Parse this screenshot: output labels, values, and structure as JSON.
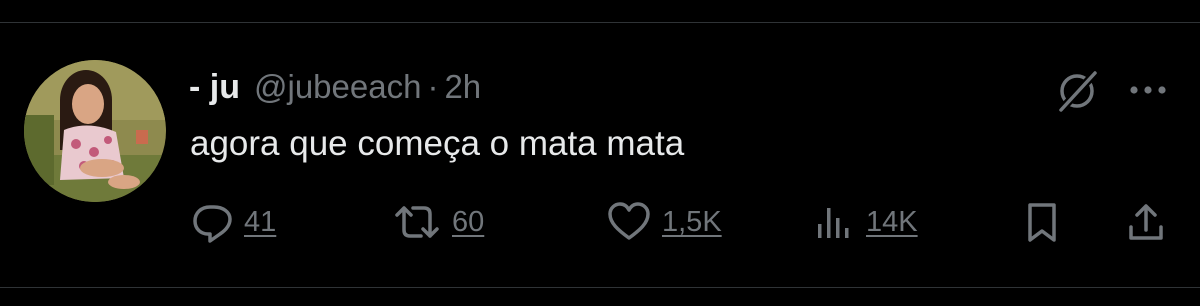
{
  "tweet": {
    "display_name": "- ju",
    "handle": "@jubeeach",
    "separator": "·",
    "timestamp": "2h",
    "text": "agora que começa o mata mata",
    "header_icons": [
      "grok-icon",
      "more-icon"
    ]
  },
  "actions": {
    "reply": {
      "icon": "reply-icon",
      "count": "41"
    },
    "retweet": {
      "icon": "retweet-icon",
      "count": "60"
    },
    "like": {
      "icon": "heart-icon",
      "count": "1,5K"
    },
    "views": {
      "icon": "views-icon",
      "count": "14K"
    },
    "bookmark": {
      "icon": "bookmark-icon"
    },
    "share": {
      "icon": "share-icon"
    }
  },
  "colors": {
    "background": "#000000",
    "primary_text": "#e7e9ea",
    "secondary_text": "#71767b",
    "divider": "#2f3336"
  }
}
